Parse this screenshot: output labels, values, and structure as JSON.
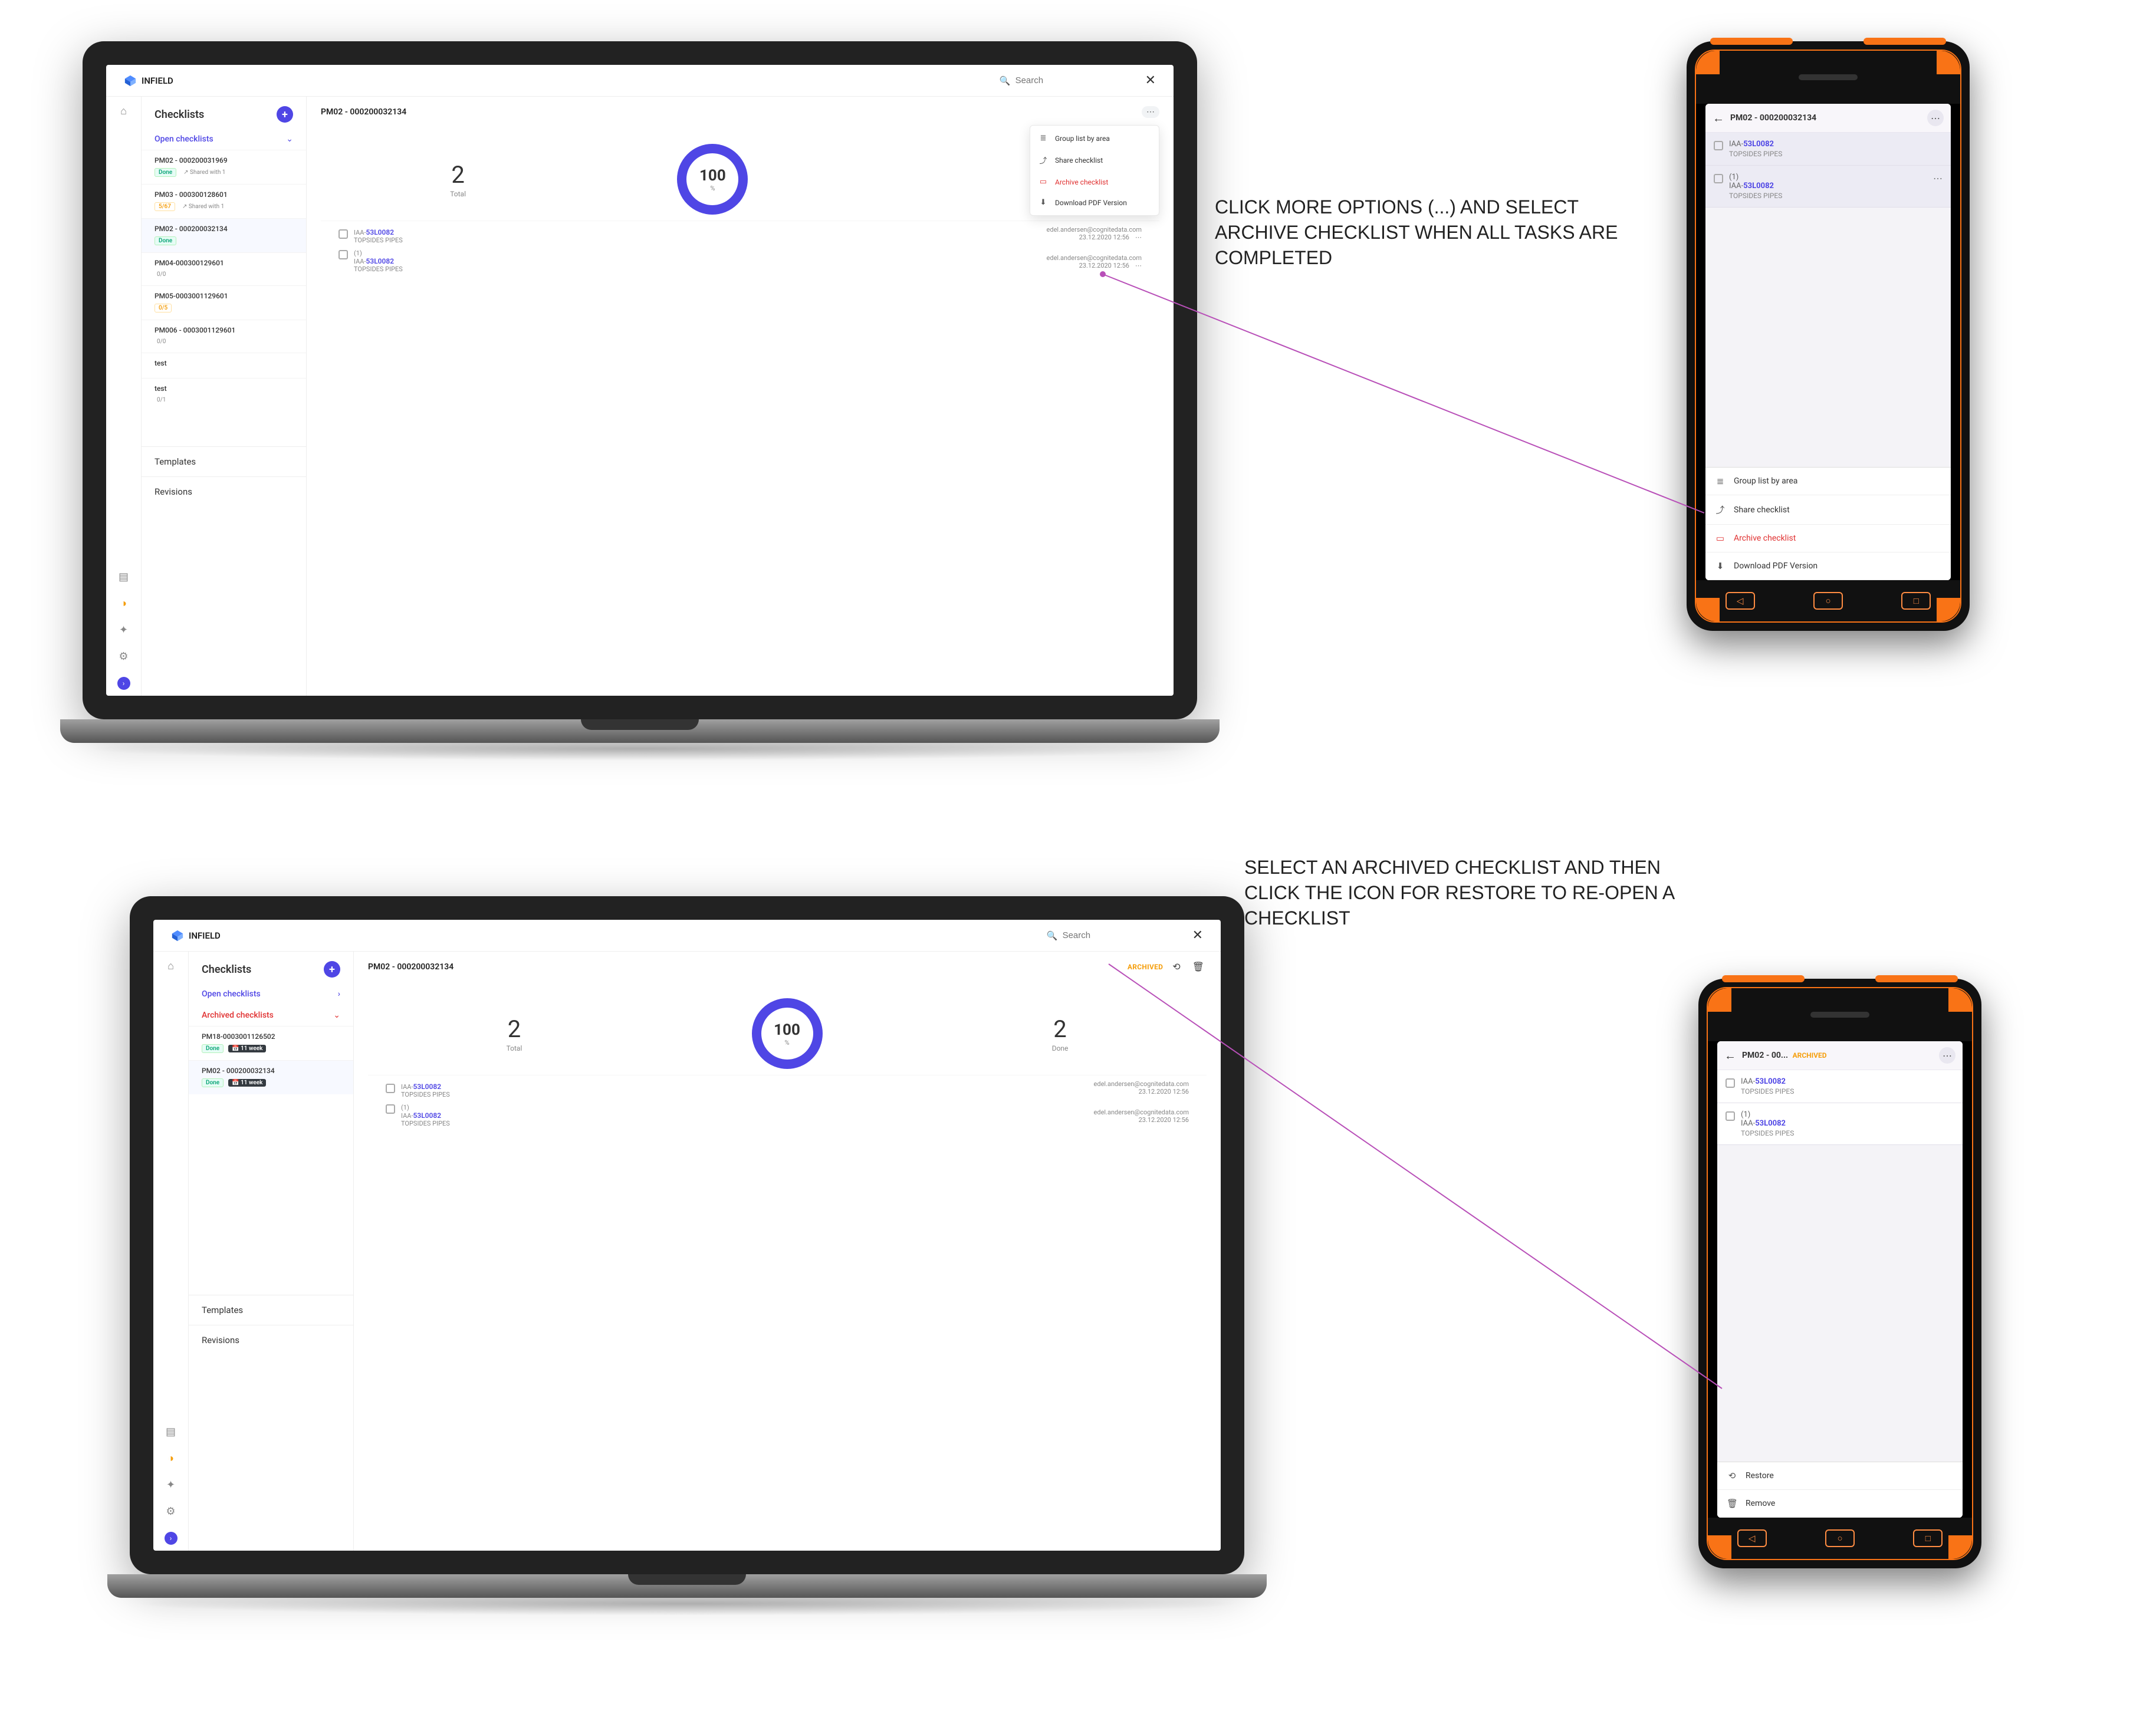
{
  "brand": "INFIELD",
  "search_placeholder": "Search",
  "annotations": {
    "top": "CLICK MORE OPTIONS (...) AND SELECT ARCHIVE CHECKLIST WHEN ALL TASKS ARE COMPLETED",
    "bottom": "SELECT AN ARCHIVED CHECKLIST AND THEN CLICK THE ICON FOR RESTORE TO RE-OPEN A CHECKLIST"
  },
  "sidebar": {
    "title": "Checklists",
    "open_label": "Open checklists",
    "archived_label": "Archived checklists",
    "templates_label": "Templates",
    "revisions_label": "Revisions",
    "done_tag": "Done",
    "shared_tag": "Shared with 1",
    "partial_5_67": "5/67",
    "partial_0_0": "0/0",
    "partial_0_5": "0/5",
    "partial_0_1": "0/1",
    "weeks11": "11 week",
    "test": "test"
  },
  "checklists_top": {
    "c1": "PM02 - 000200031969",
    "c2": "PM03 - 000300128601",
    "c3": "PM02 - 000200032134",
    "c4": "PM04-000300129601",
    "c5": "PM05-0003001129601",
    "c6": "PM006 - 0003001129601"
  },
  "checklists_bottom": {
    "c1": "PM18-0003001126502",
    "c2": "PM02 - 000200032134"
  },
  "main": {
    "title": "PM02 - 000200032134",
    "title_short": "PM02 - 00...",
    "archived_badge": "ARCHIVED",
    "archived_badge2": "ARCHIVED",
    "total_num": "2",
    "total_lbl": "Total",
    "done_num": "2",
    "done_lbl": "Done",
    "pct": "100",
    "pct_unit": "%"
  },
  "tasks": {
    "prefix1": "IAA-",
    "tag": "53L0082",
    "pipes": "TOPSIDES PIPES",
    "one": "(1)"
  },
  "meta": {
    "owner1": "edel.andersen@cognitedata.com",
    "owner2": "edel.andersen@cognitedata.com",
    "date": "23.12.2020 12:56"
  },
  "menu": {
    "group": "Group list by area",
    "share": "Share checklist",
    "archive": "Archive checklist",
    "pdf": "Download PDF Version",
    "restore": "Restore",
    "remove": "Remove"
  }
}
